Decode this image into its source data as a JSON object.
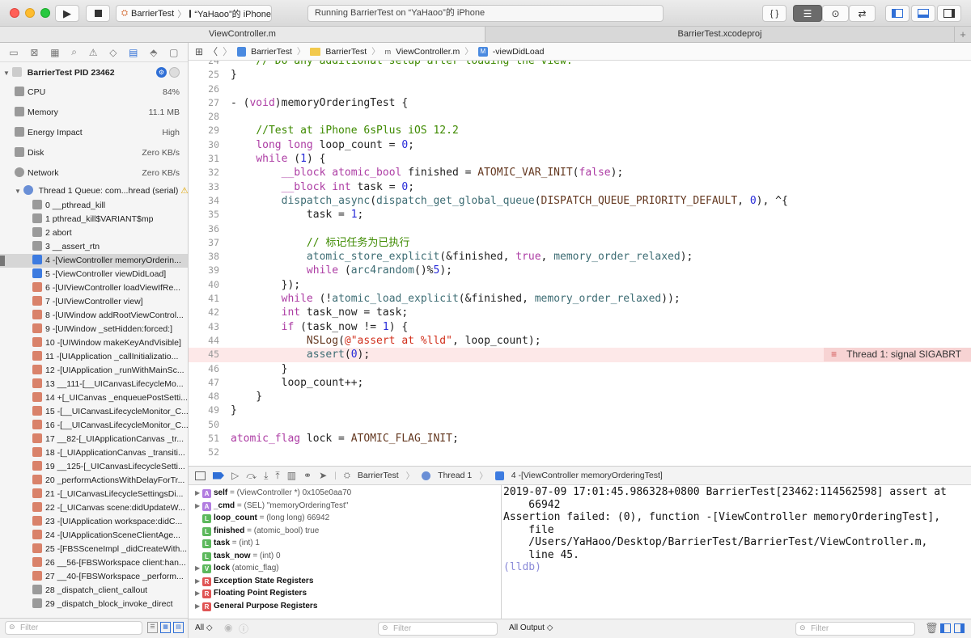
{
  "toolbar": {
    "scheme_target": "BarrierTest",
    "scheme_device": "“YaHaoo”的 iPhone",
    "activity_status": "Running BarrierTest on “YaHaoo”的 iPhone"
  },
  "tabs": [
    {
      "label": "ViewController.m"
    },
    {
      "label": "BarrierTest.xcodeproj"
    }
  ],
  "navigator": {
    "process": "BarrierTest PID 23462",
    "gauges": [
      {
        "label": "CPU",
        "value": "84%"
      },
      {
        "label": "Memory",
        "value": "11.1 MB"
      },
      {
        "label": "Energy Impact",
        "value": "High"
      },
      {
        "label": "Disk",
        "value": "Zero KB/s"
      },
      {
        "label": "Network",
        "value": "Zero KB/s"
      }
    ],
    "thread": "Thread 1 Queue: com...hread (serial)",
    "frames": [
      "0 __pthread_kill",
      "1 pthread_kill$VARIANT$mp",
      "2 abort",
      "3 __assert_rtn",
      "4 -[ViewController memoryOrderin...",
      "5 -[ViewController viewDidLoad]",
      "6 -[UIViewController loadViewIfRe...",
      "7 -[UIViewController view]",
      "8 -[UIWindow addRootViewControl...",
      "9 -[UIWindow _setHidden:forced:]",
      "10 -[UIWindow makeKeyAndVisible]",
      "11 -[UIApplication _callInitializatio...",
      "12 -[UIApplication _runWithMainSc...",
      "13 __111-[__UICanvasLifecycleMo...",
      "14 +[_UICanvas _enqueuePostSetti...",
      "15 -[__UICanvasLifecycleMonitor_C...",
      "16 -[__UICanvasLifecycleMonitor_C...",
      "17 __82-[_UIApplicationCanvas _tr...",
      "18 -[_UIApplicationCanvas _transiti...",
      "19 __125-[_UICanvasLifecycleSetti...",
      "20 _performActionsWithDelayForTr...",
      "21 -[_UICanvasLifecycleSettingsDi...",
      "22 -[_UICanvas scene:didUpdateW...",
      "23 -[UIApplication workspace:didC...",
      "24 -[UIApplicationSceneClientAge...",
      "25 -[FBSSceneImpl _didCreateWith...",
      "26 __56-[FBSWorkspace client:han...",
      "27 __40-[FBSWorkspace _perform...",
      "28 _dispatch_client_callout",
      "29 _dispatch_block_invoke_direct"
    ],
    "selected_frame_index": 4,
    "filter_placeholder": "Filter"
  },
  "jumpbar": {
    "crumbs": [
      "BarrierTest",
      "BarrierTest",
      "ViewController.m",
      "-viewDidLoad"
    ]
  },
  "code": {
    "lines": [
      {
        "num": "24",
        "text": "    // Do any additional setup after loading the view."
      },
      {
        "num": "25",
        "text": "}"
      },
      {
        "num": "26",
        "text": ""
      },
      {
        "num": "27",
        "text": "- (void)memoryOrderingTest {"
      },
      {
        "num": "28",
        "text": ""
      },
      {
        "num": "29",
        "text": "    //Test at iPhone 6sPlus iOS 12.2"
      },
      {
        "num": "30",
        "text": "    long long loop_count = 0;"
      },
      {
        "num": "31",
        "text": "    while (1) {"
      },
      {
        "num": "32",
        "text": "        __block atomic_bool finished = ATOMIC_VAR_INIT(false);"
      },
      {
        "num": "33",
        "text": "        __block int task = 0;"
      },
      {
        "num": "34",
        "text": "        dispatch_async(dispatch_get_global_queue(DISPATCH_QUEUE_PRIORITY_DEFAULT, 0), ^{"
      },
      {
        "num": "35",
        "text": "            task = 1;"
      },
      {
        "num": "36",
        "text": ""
      },
      {
        "num": "37",
        "text": "            // 标记任务为已执行"
      },
      {
        "num": "38",
        "text": "            atomic_store_explicit(&finished, true, memory_order_relaxed);"
      },
      {
        "num": "39",
        "text": "            while (arc4random()%5);"
      },
      {
        "num": "40",
        "text": "        });"
      },
      {
        "num": "41",
        "text": "        while (!atomic_load_explicit(&finished, memory_order_relaxed));"
      },
      {
        "num": "42",
        "text": "        int task_now = task;"
      },
      {
        "num": "43",
        "text": "        if (task_now != 1) {"
      },
      {
        "num": "44",
        "text": "            NSLog(@\"assert at %lld\", loop_count);"
      },
      {
        "num": "45",
        "text": "            assert(0);"
      },
      {
        "num": "46",
        "text": "        }"
      },
      {
        "num": "47",
        "text": "        loop_count++;"
      },
      {
        "num": "48",
        "text": "    }"
      },
      {
        "num": "49",
        "text": "}"
      },
      {
        "num": "50",
        "text": ""
      },
      {
        "num": "51",
        "text": "atomic_flag lock = ATOMIC_FLAG_INIT;"
      },
      {
        "num": "52",
        "text": ""
      }
    ],
    "error_line_index": 21,
    "error_message": "Thread 1: signal SIGABRT"
  },
  "debugbar": {
    "crumbs": [
      "BarrierTest",
      "Thread 1",
      "4 -[ViewController memoryOrderingTest]"
    ]
  },
  "variables": [
    {
      "badge": "A",
      "name": "self",
      "meta": " = (ViewController *) 0x105e0aa70",
      "expandable": true
    },
    {
      "badge": "A",
      "name": "_cmd",
      "meta": " = (SEL) \"memoryOrderingTest\"",
      "expandable": true
    },
    {
      "badge": "L",
      "name": "loop_count",
      "meta": " = (long long) 66942",
      "expandable": false
    },
    {
      "badge": "L",
      "name": "finished",
      "meta": " = (atomic_bool) true",
      "expandable": false
    },
    {
      "badge": "L",
      "name": "task",
      "meta": " = (int) 1",
      "expandable": false
    },
    {
      "badge": "L",
      "name": "task_now",
      "meta": " = (int) 0",
      "expandable": false
    },
    {
      "badge": "V",
      "name": "lock",
      "meta": " (atomic_flag)",
      "expandable": true
    },
    {
      "badge": "R",
      "name": "Exception State Registers",
      "meta": "",
      "expandable": true
    },
    {
      "badge": "R",
      "name": "Floating Point Registers",
      "meta": "",
      "expandable": true
    },
    {
      "badge": "R",
      "name": "General Purpose Registers",
      "meta": "",
      "expandable": true
    }
  ],
  "console": {
    "lines": [
      "2019-07-09 17:01:45.986328+0800 BarrierTest[23462:114562598] assert at",
      "    66942",
      "Assertion failed: (0), function -[ViewController memoryOrderingTest],",
      "    file",
      "    /Users/YaHaoo/Desktop/BarrierTest/BarrierTest/ViewController.m,",
      "    line 45."
    ],
    "prompt": "(lldb)"
  },
  "bottom": {
    "vars_scope": "All ◇",
    "vars_filter": "Filter",
    "console_scope": "All Output ◇",
    "console_filter": "Filter"
  },
  "colors": {
    "keyword": "#ad3da4",
    "comment": "#3e8a00",
    "string": "#d12f1b",
    "number": "#272ad8",
    "macro": "#643820",
    "error_bg": "#fde8e8",
    "close": "#ff5f57",
    "minimize": "#febc2e",
    "zoom": "#28c840"
  }
}
